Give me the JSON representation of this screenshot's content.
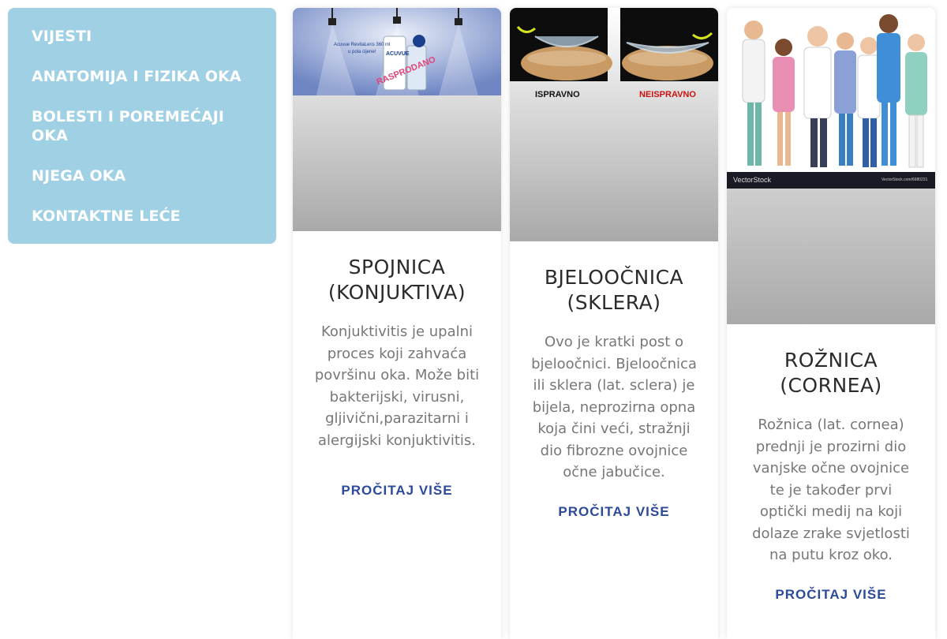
{
  "nav": {
    "items": [
      {
        "label": "VIJESTI"
      },
      {
        "label": "ANATOMIJA I FIZIKA OKA"
      },
      {
        "label": "BOLESTI I POREMEĆAJI OKA"
      },
      {
        "label": "NJEGA OKA"
      },
      {
        "label": "KONTAKTNE LEĆE"
      }
    ]
  },
  "cards": [
    {
      "title": "SPOJNICA (KONJUKTIVA)",
      "text": "Konjuktivitis je upalni proces koji zahvaća površinu oka. Može biti bakterijski, virusni, gljivični,parazitarni i alergijski konjuktivitis.",
      "link": "PROČITAJ VIŠE",
      "image_text": [
        "Acuvue RevitaLens 360 ml",
        "u pola cijene!",
        "ACUVUE",
        "RASPRODANO"
      ]
    },
    {
      "title": "BJELOOČNICA (SKLERA)",
      "text": "Ovo je kratki post o bjeloočnici. Bjeloočnica ili sklera (lat. sclera) je bijela, neprozirna opna koja čini veći, stražnji dio fibrozne ovojnice očne jabučice.",
      "link": "PROČITAJ VIŠE",
      "image_labels": {
        "left": "ISPRAVNO",
        "right": "NEISPRAVNO"
      }
    },
    {
      "title": "ROŽNICA (CORNEA)",
      "text": "Rožnica (lat. cornea) prednji je prozirni dio vanjske očne ovojnice te je također prvi optički medij na koji dolaze zrake svjetlosti na putu kroz oko.",
      "link": "PROČITAJ VIŠE",
      "image_text": {
        "brand": "VectorStock",
        "id": "VectorStock.com/6980231"
      }
    }
  ],
  "colors": {
    "sidebar_bg": "#9fd0e3",
    "link": "#2c4a9a",
    "title": "#2b2b2b",
    "body_text": "#777777",
    "neispravno": "#cc1111"
  }
}
